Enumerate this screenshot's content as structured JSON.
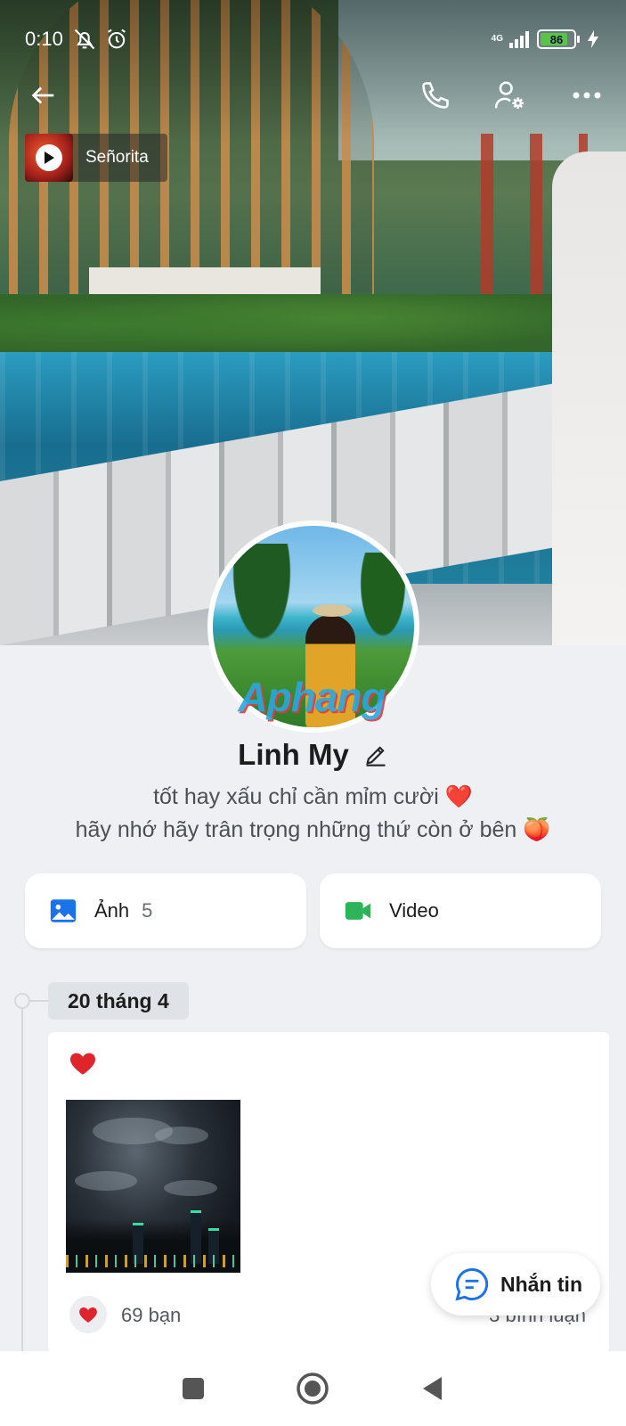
{
  "status_bar": {
    "time": "0:10",
    "network": "4G",
    "battery": "86",
    "battery_level": 0.86,
    "icons": [
      "mute-icon",
      "alarm-icon",
      "signal-icon",
      "battery-icon",
      "charging-icon"
    ]
  },
  "header": {
    "icons": [
      "back-arrow-icon",
      "phone-icon",
      "user-settings-icon",
      "more-icon"
    ]
  },
  "music": {
    "title": "Señorita",
    "icon": "play-icon"
  },
  "profile": {
    "watermark": "Aphang",
    "name": "Linh My",
    "bio_line_1": "tốt hay xấu chỉ cần mỉm cười ❤️",
    "bio_line_2": "hãy nhớ hãy trân trọng những thứ còn ở bên 🍑"
  },
  "media": {
    "photos_label": "Ảnh",
    "photos_count": "5",
    "video_label": "Video",
    "photos_color": "#1a73e8",
    "video_color": "#2bb45a"
  },
  "timeline": {
    "date": "20 tháng 4",
    "post": {
      "emoji": "❤️",
      "likes": "69 bạn",
      "comments": "3 bình luận"
    }
  },
  "actions": {
    "message_label": "Nhắn tin"
  },
  "nav": {
    "icons": [
      "recents-icon",
      "home-icon",
      "back-icon"
    ]
  }
}
